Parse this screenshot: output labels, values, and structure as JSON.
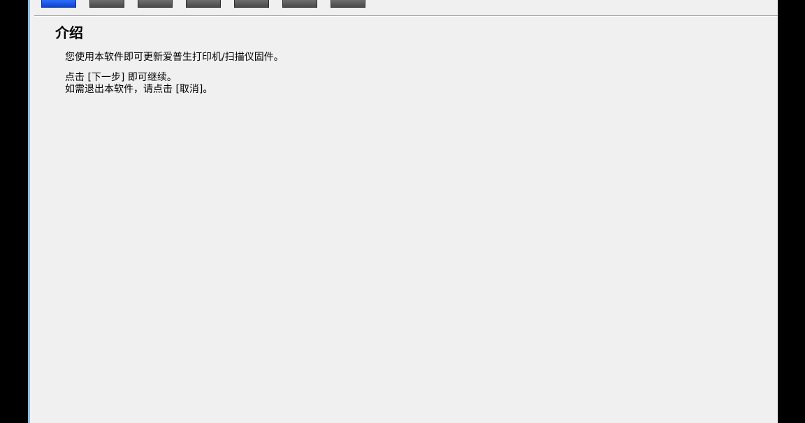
{
  "wizard": {
    "steps": [
      {
        "state": "active"
      },
      {
        "state": "inactive"
      },
      {
        "state": "inactive"
      },
      {
        "state": "inactive"
      },
      {
        "state": "inactive"
      },
      {
        "state": "inactive"
      },
      {
        "state": "inactive"
      }
    ],
    "active_color": "#0a44d8",
    "inactive_color": "#4a4a4a"
  },
  "page": {
    "title": "介绍",
    "description": "您使用本软件即可更新爱普生打印机/扫描仪固件。",
    "next_instruction": "点击 [下一步] 即可继续。",
    "cancel_instruction": "如需退出本软件，请点击 [取消]。"
  }
}
